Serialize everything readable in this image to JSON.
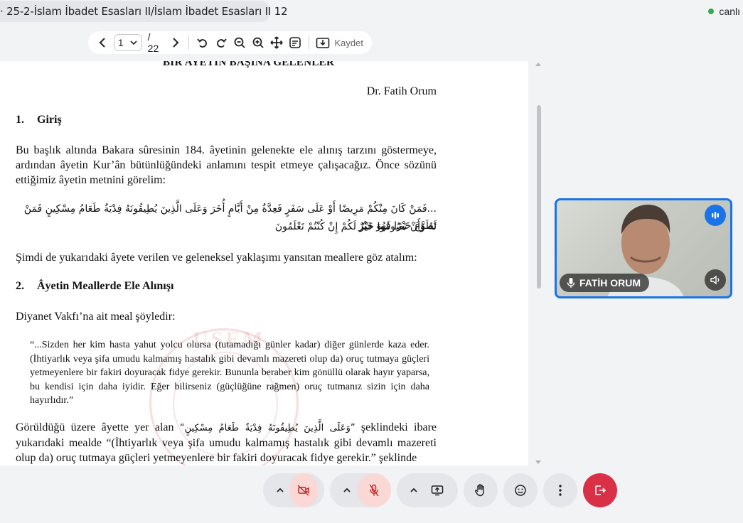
{
  "header": {
    "title": "· 25-2-İslam İbadet Esasları II/İslam İbadet Esasları II 12",
    "live_label": "canlı",
    "live_color": "#34a853"
  },
  "pdf_toolbar": {
    "page_current": "1",
    "page_total": "/ 22",
    "save_label": "Kaydet",
    "icons": [
      "chevron-left-icon",
      "chevron-down-icon",
      "chevron-right-icon",
      "rotate-left-icon",
      "rotate-right-icon",
      "zoom-out-icon",
      "zoom-in-icon",
      "move-icon",
      "fit-page-icon",
      "download-icon"
    ]
  },
  "document": {
    "top_heading": "BIR AYETIN BAŞINA GELENLER",
    "author": "Dr. Fatih Orum",
    "section1_num": "1.",
    "section1_title": "Giriş",
    "para1": "Bu başlık altında Bakara sûresinin 184. âyetinin gelenekte ele alınış tarzını göstermeye, ardından âyetin Kur’ân bütünlüğündeki anlamını tespit etmeye çalışacağız. Önce sözünü ettiğimiz âyetin metnini görelim:",
    "arabic1": "...فَمَنْ كَانَ مِنْكُمْ مَرِيضًا أَوْ عَلَى سَفَرٍ فَعِدَّةٌ مِنْ أَيَّامٍ أُخَرَ وَعَلَى الَّذِينَ يُطِيقُونَهُ فِدْيَةٌ طَعَامُ مِسْكِينٍ فَمَنْ تَطَوَّعَ خَيْرًا فَهُوَ خَيْرٌ",
    "arabic2": "لَهُ وَأَنْ تَصُومُوا خَيْرٌ لَكُمْ إِنْ كُنْتُمْ تَعْلَمُونَ",
    "para2": "Şimdi de yukarıdaki âyete verilen ve geleneksel yaklaşımı yansıtan meallere göz atalım:",
    "section2_num": "2.",
    "section2_title": "Âyetin Meallerde Ele Alınışı",
    "para3": "Diyanet Vakfı’na ait meal şöyledir:",
    "quote": "“...Sizden her kim hasta yahut yolcu olursa (tutamadığı günler kadar) diğer günlerde kaza eder. (İhtiyarlık veya şifa umudu kalmamış hastalık gibi devamlı mazereti olup da) oruç tutmaya güçleri yetmeyenlere bir fakiri doyuracak fidye gerekir. Bununla beraber kim gönüllü olarak hayır yaparsa, bu kendisi için daha iyidir. Eğer bilirseniz (güçlüğüne rağmen) oruç tutmanız sizin için daha hayırlıdır.”",
    "para4_start": "Görüldüğü üzere âyette yer alan ",
    "para4_arabic": "“وَعَلَى الَّذِينَ يُطِيقُونَهُ فِدْيَةٌ طَعَامُ مِسْكِينٍ”",
    "para4_end": " şeklindeki ibare yukarıdaki mealde “(İhtiyarlık veya şifa umudu kalmamış hastalık gibi devamlı mazereti olup da) oruç tutmaya güçleri yetmeyenlere bir fakiri doyuracak fidye gerekir.” şeklinde",
    "stamp_text": "USEM",
    "stamp_side_right": "MERK",
    "stamp_side_left": "M"
  },
  "video_tile": {
    "participant_name": "FATİH ORUM",
    "border_color": "#1a73e8"
  },
  "controls": {
    "leave_color": "#d93048",
    "icons": [
      "camera-options-chevron-icon",
      "camera-off-icon",
      "mic-options-chevron-icon",
      "mic-off-icon",
      "share-options-chevron-icon",
      "share-screen-icon",
      "raise-hand-icon",
      "emoji-icon",
      "more-options-icon",
      "leave-call-icon"
    ]
  }
}
